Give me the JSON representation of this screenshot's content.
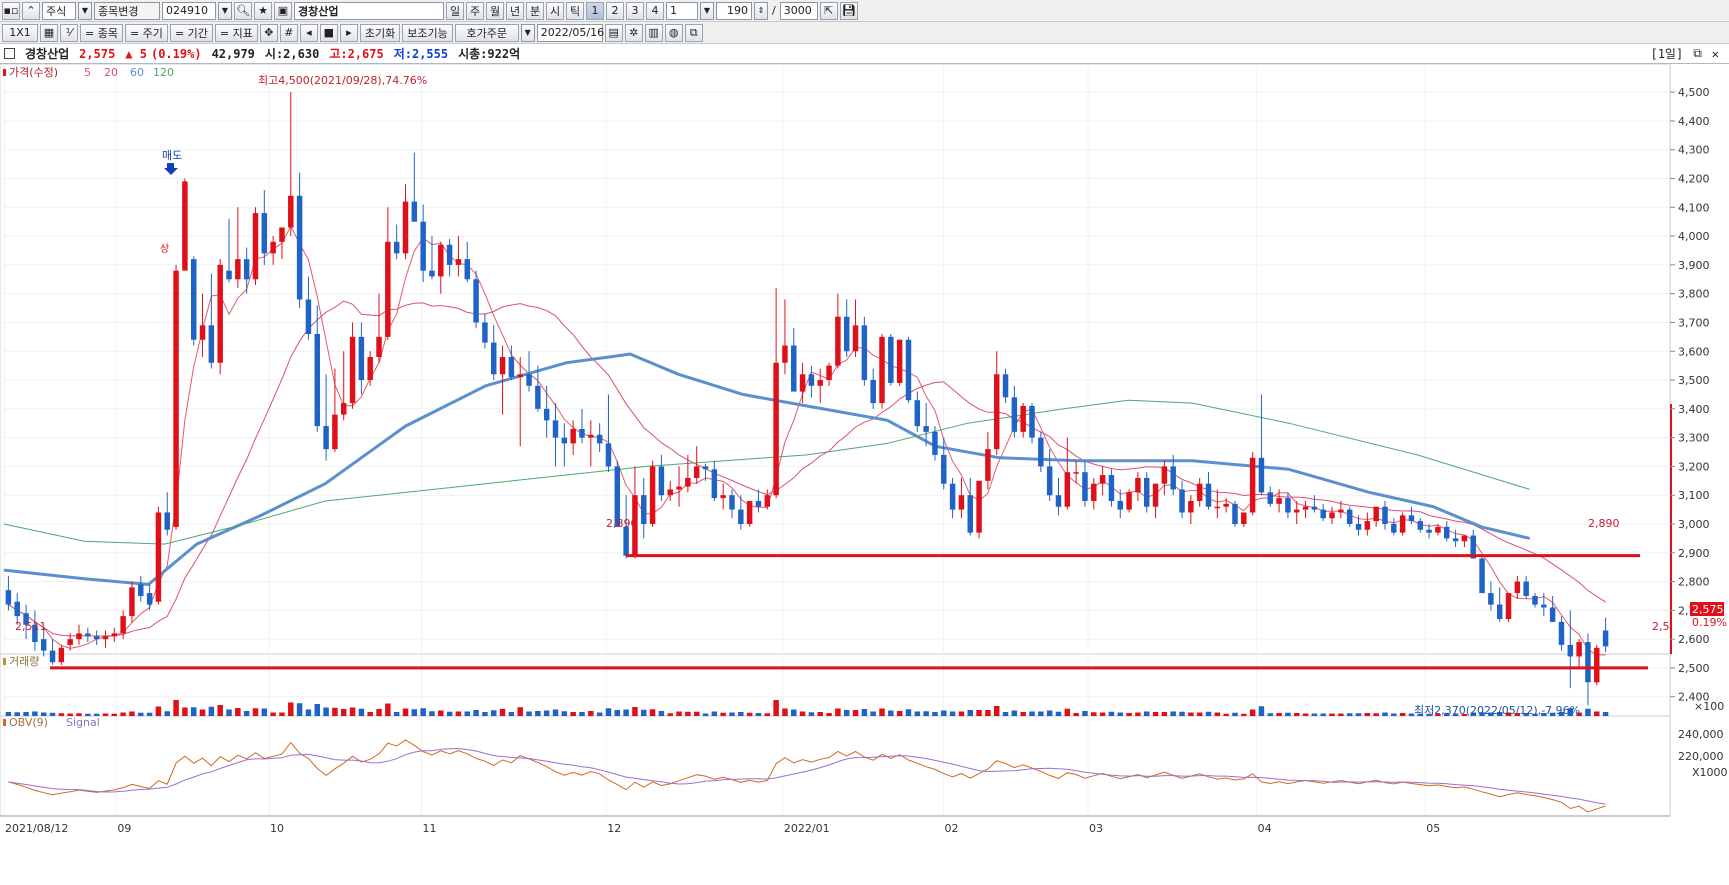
{
  "toolbar1": {
    "market": "주식",
    "stock_change": "종목변경",
    "code": "024910",
    "name": "경창산업",
    "periods": [
      "일",
      "주",
      "월",
      "년",
      "분",
      "시",
      "틱"
    ],
    "nums": [
      "1",
      "2",
      "3",
      "4"
    ],
    "interval": "1",
    "count": "190",
    "total": "3000"
  },
  "toolbar2": {
    "grid": "1X1",
    "buttons": [
      "= 종목",
      "= 주기",
      "= 기간",
      "= 지표"
    ],
    "reset": "초기화",
    "aux": "보조기능",
    "order": "호가주문",
    "date": "2022/05/16"
  },
  "info": {
    "name": "경창산업",
    "price": "2,575",
    "change": "▲ 5",
    "change_pct": "(0.19%)",
    "volume": "42,979",
    "open": "시:2,630",
    "high": "고:2,675",
    "low": "저:2,555",
    "mcap": "시총:922억",
    "period_badge": "[1일]"
  },
  "legend": {
    "price": "가격(수정)",
    "ma": [
      "5",
      "20",
      "60",
      "120"
    ],
    "volume": "거래량",
    "obv": "OBV(9)",
    "signal": "Signal"
  },
  "colors": {
    "up": "#e0101a",
    "down": "#1f63c6",
    "ma5": "#e25a6a",
    "ma20": "#d8507a",
    "ma60": "#5b8fd0",
    "ma120": "#4daa6e",
    "obv": "#d06a20",
    "signal": "#9a70d0"
  },
  "annotations": {
    "high": "최고4,500(2021/09/28),74.76%",
    "low": "최저2,370(2022/05/12),-7.96%",
    "sell": "매도",
    "limit_up": "상",
    "level1_left": "2,890",
    "level1_right": "2,890",
    "level2_left": "2,511",
    "level2_right": "2,5",
    "last_price": "2,575",
    "last_pct": "0.19%"
  },
  "axis": {
    "price_ticks": [
      "4,500",
      "4,400",
      "4,300",
      "4,200",
      "4,100",
      "4,000",
      "3,900",
      "3,800",
      "3,700",
      "3,600",
      "3,500",
      "3,400",
      "3,300",
      "3,200",
      "3,100",
      "3,000",
      "2,900",
      "2,800",
      "2,700",
      "2,600",
      "2,500",
      "2,400"
    ],
    "volume_unit": "×100",
    "obv_ticks": [
      "240,000",
      "220,000"
    ],
    "obv_unit": "X1000",
    "x_labels": [
      "2021/08/12",
      "09",
      "10",
      "11",
      "12",
      "2022/01",
      "02",
      "03",
      "04",
      "05"
    ]
  },
  "chart_data": {
    "type": "candlestick",
    "ylim": [
      2340,
      4570
    ],
    "levels": [
      2890,
      2500
    ],
    "candles": [
      [
        2770,
        2820,
        2700,
        2720
      ],
      [
        2730,
        2760,
        2650,
        2680
      ],
      [
        2690,
        2720,
        2600,
        2650
      ],
      [
        2650,
        2700,
        2560,
        2590
      ],
      [
        2600,
        2640,
        2540,
        2560
      ],
      [
        2560,
        2600,
        2511,
        2520
      ],
      [
        2520,
        2580,
        2510,
        2570
      ],
      [
        2580,
        2620,
        2560,
        2600
      ],
      [
        2600,
        2650,
        2580,
        2620
      ],
      [
        2620,
        2640,
        2590,
        2610
      ],
      [
        2610,
        2630,
        2580,
        2600
      ],
      [
        2600,
        2630,
        2570,
        2610
      ],
      [
        2610,
        2640,
        2590,
        2620
      ],
      [
        2620,
        2700,
        2600,
        2680
      ],
      [
        2680,
        2800,
        2660,
        2780
      ],
      [
        2790,
        2820,
        2730,
        2750
      ],
      [
        2760,
        2790,
        2700,
        2720
      ],
      [
        2730,
        3060,
        2720,
        3040
      ],
      [
        3040,
        3110,
        2960,
        2980
      ],
      [
        2990,
        3900,
        2980,
        3880
      ],
      [
        3880,
        4200,
        3900,
        4190
      ],
      [
        3920,
        3930,
        3620,
        3640
      ],
      [
        3640,
        3800,
        3580,
        3690
      ],
      [
        3690,
        3870,
        3540,
        3560
      ],
      [
        3560,
        3920,
        3520,
        3900
      ],
      [
        3880,
        4060,
        3840,
        3850
      ],
      [
        3850,
        4100,
        3820,
        3920
      ],
      [
        3920,
        3960,
        3800,
        3850
      ],
      [
        3850,
        4100,
        3830,
        4080
      ],
      [
        4080,
        4160,
        3900,
        3940
      ],
      [
        3940,
        4000,
        3900,
        3980
      ],
      [
        3980,
        4020,
        3920,
        4030
      ],
      [
        4030,
        4500,
        4000,
        4140
      ],
      [
        4140,
        4220,
        3750,
        3780
      ],
      [
        3780,
        3860,
        3640,
        3660
      ],
      [
        3660,
        3760,
        3320,
        3340
      ],
      [
        3340,
        3520,
        3220,
        3260
      ],
      [
        3260,
        3540,
        3250,
        3380
      ],
      [
        3380,
        3600,
        3360,
        3420
      ],
      [
        3420,
        3700,
        3400,
        3650
      ],
      [
        3650,
        3700,
        3450,
        3500
      ],
      [
        3500,
        3600,
        3480,
        3580
      ],
      [
        3580,
        3800,
        3560,
        3650
      ],
      [
        3650,
        4100,
        3640,
        3980
      ],
      [
        3980,
        4040,
        3920,
        3940
      ],
      [
        3940,
        4180,
        3920,
        4120
      ],
      [
        4120,
        4290,
        4060,
        4050
      ],
      [
        4050,
        4110,
        3840,
        3880
      ],
      [
        3880,
        4000,
        3850,
        3860
      ],
      [
        3860,
        3980,
        3800,
        3970
      ],
      [
        3970,
        3990,
        3860,
        3900
      ],
      [
        3900,
        4000,
        3860,
        3920
      ],
      [
        3920,
        3980,
        3840,
        3850
      ],
      [
        3850,
        3880,
        3680,
        3700
      ],
      [
        3700,
        3730,
        3610,
        3630
      ],
      [
        3630,
        3690,
        3500,
        3520
      ],
      [
        3520,
        3620,
        3380,
        3580
      ],
      [
        3580,
        3620,
        3500,
        3510
      ],
      [
        3510,
        3580,
        3270,
        3520
      ],
      [
        3520,
        3600,
        3460,
        3480
      ],
      [
        3480,
        3550,
        3390,
        3400
      ],
      [
        3400,
        3480,
        3300,
        3360
      ],
      [
        3360,
        3420,
        3200,
        3300
      ],
      [
        3300,
        3350,
        3200,
        3280
      ],
      [
        3280,
        3360,
        3240,
        3330
      ],
      [
        3330,
        3400,
        3280,
        3300
      ],
      [
        3300,
        3360,
        3200,
        3310
      ],
      [
        3310,
        3350,
        3250,
        3280
      ],
      [
        3280,
        3450,
        3180,
        3200
      ],
      [
        3200,
        3220,
        3020,
        2990
      ],
      [
        2990,
        3100,
        2880,
        2890
      ],
      [
        2890,
        3200,
        2880,
        3100
      ],
      [
        3100,
        3160,
        2950,
        3000
      ],
      [
        3000,
        3220,
        2990,
        3200
      ],
      [
        3200,
        3240,
        3080,
        3100
      ],
      [
        3100,
        3150,
        3080,
        3120
      ],
      [
        3120,
        3200,
        3060,
        3130
      ],
      [
        3130,
        3240,
        3110,
        3160
      ],
      [
        3160,
        3270,
        3140,
        3200
      ],
      [
        3200,
        3210,
        3150,
        3190
      ],
      [
        3190,
        3220,
        3080,
        3090
      ],
      [
        3090,
        3140,
        3050,
        3100
      ],
      [
        3100,
        3120,
        3020,
        3050
      ],
      [
        3050,
        3100,
        2980,
        3000
      ],
      [
        3000,
        3080,
        2990,
        3080
      ],
      [
        3080,
        3120,
        3040,
        3060
      ],
      [
        3060,
        3120,
        3050,
        3100
      ],
      [
        3100,
        3820,
        3090,
        3560
      ],
      [
        3560,
        3780,
        3520,
        3620
      ],
      [
        3620,
        3680,
        3460,
        3460
      ],
      [
        3460,
        3560,
        3420,
        3520
      ],
      [
        3520,
        3550,
        3440,
        3480
      ],
      [
        3480,
        3540,
        3420,
        3500
      ],
      [
        3500,
        3560,
        3480,
        3550
      ],
      [
        3550,
        3800,
        3540,
        3720
      ],
      [
        3720,
        3780,
        3580,
        3600
      ],
      [
        3600,
        3780,
        3580,
        3690
      ],
      [
        3690,
        3720,
        3480,
        3500
      ],
      [
        3500,
        3540,
        3400,
        3420
      ],
      [
        3420,
        3660,
        3400,
        3650
      ],
      [
        3650,
        3660,
        3480,
        3490
      ],
      [
        3490,
        3640,
        3480,
        3640
      ],
      [
        3640,
        3650,
        3420,
        3430
      ],
      [
        3430,
        3460,
        3320,
        3340
      ],
      [
        3340,
        3420,
        3270,
        3320
      ],
      [
        3320,
        3340,
        3220,
        3240
      ],
      [
        3240,
        3300,
        3120,
        3140
      ],
      [
        3140,
        3160,
        3020,
        3050
      ],
      [
        3050,
        3160,
        3020,
        3100
      ],
      [
        3100,
        3160,
        2960,
        2970
      ],
      [
        2970,
        3150,
        2950,
        3150
      ],
      [
        3150,
        3320,
        3120,
        3260
      ],
      [
        3260,
        3600,
        3240,
        3520
      ],
      [
        3520,
        3540,
        3420,
        3440
      ],
      [
        3440,
        3480,
        3300,
        3320
      ],
      [
        3320,
        3420,
        3300,
        3410
      ],
      [
        3410,
        3420,
        3280,
        3300
      ],
      [
        3300,
        3320,
        3180,
        3200
      ],
      [
        3200,
        3260,
        3080,
        3100
      ],
      [
        3100,
        3160,
        3030,
        3060
      ],
      [
        3060,
        3300,
        3050,
        3180
      ],
      [
        3180,
        3220,
        3140,
        3180
      ],
      [
        3180,
        3220,
        3060,
        3080
      ],
      [
        3080,
        3160,
        3050,
        3140
      ],
      [
        3140,
        3200,
        3100,
        3170
      ],
      [
        3170,
        3190,
        3060,
        3080
      ],
      [
        3080,
        3120,
        3020,
        3050
      ],
      [
        3050,
        3120,
        3040,
        3110
      ],
      [
        3110,
        3180,
        3080,
        3160
      ],
      [
        3160,
        3180,
        3040,
        3060
      ],
      [
        3060,
        3140,
        3020,
        3140
      ],
      [
        3140,
        3220,
        3100,
        3200
      ],
      [
        3200,
        3240,
        3100,
        3120
      ],
      [
        3120,
        3150,
        3020,
        3040
      ],
      [
        3040,
        3100,
        3000,
        3080
      ],
      [
        3080,
        3160,
        3060,
        3140
      ],
      [
        3140,
        3180,
        3050,
        3060
      ],
      [
        3060,
        3120,
        3020,
        3060
      ],
      [
        3060,
        3090,
        3040,
        3070
      ],
      [
        3070,
        3080,
        2990,
        3000
      ],
      [
        3000,
        3040,
        2990,
        3040
      ],
      [
        3040,
        3250,
        3030,
        3230
      ],
      [
        3230,
        3450,
        3100,
        3110
      ],
      [
        3110,
        3130,
        3060,
        3070
      ],
      [
        3070,
        3120,
        3040,
        3090
      ],
      [
        3090,
        3110,
        3020,
        3040
      ],
      [
        3040,
        3080,
        3000,
        3050
      ],
      [
        3050,
        3080,
        3020,
        3060
      ],
      [
        3060,
        3100,
        3040,
        3050
      ],
      [
        3050,
        3070,
        3010,
        3020
      ],
      [
        3020,
        3060,
        3000,
        3040
      ],
      [
        3040,
        3080,
        3020,
        3050
      ],
      [
        3050,
        3060,
        2990,
        3000
      ],
      [
        3000,
        3030,
        2960,
        2980
      ],
      [
        2980,
        3040,
        2960,
        3010
      ],
      [
        3010,
        3060,
        2990,
        3060
      ],
      [
        3060,
        3080,
        2980,
        3000
      ],
      [
        3000,
        3020,
        2960,
        2970
      ],
      [
        2970,
        3040,
        2960,
        3030
      ],
      [
        3030,
        3060,
        3000,
        3010
      ],
      [
        3010,
        3020,
        2970,
        2980
      ],
      [
        2980,
        3000,
        2950,
        2970
      ],
      [
        2970,
        3000,
        2960,
        2990
      ],
      [
        2990,
        3010,
        2940,
        2950
      ],
      [
        2950,
        2980,
        2920,
        2940
      ],
      [
        2940,
        2960,
        2920,
        2960
      ],
      [
        2960,
        2980,
        2880,
        2880
      ],
      [
        2880,
        2890,
        2780,
        2760
      ],
      [
        2760,
        2800,
        2700,
        2720
      ],
      [
        2720,
        2780,
        2660,
        2670
      ],
      [
        2670,
        2760,
        2660,
        2760
      ],
      [
        2760,
        2820,
        2740,
        2800
      ],
      [
        2800,
        2820,
        2740,
        2750
      ],
      [
        2750,
        2760,
        2710,
        2720
      ],
      [
        2720,
        2760,
        2680,
        2710
      ],
      [
        2710,
        2750,
        2660,
        2660
      ],
      [
        2660,
        2680,
        2560,
        2580
      ],
      [
        2580,
        2700,
        2430,
        2540
      ],
      [
        2540,
        2600,
        2500,
        2590
      ],
      [
        2590,
        2620,
        2370,
        2450
      ],
      [
        2450,
        2580,
        2440,
        2570
      ],
      [
        2630,
        2675,
        2555,
        2575
      ]
    ],
    "ma60": [
      [
        0,
        2840
      ],
      [
        0.05,
        2810
      ],
      [
        0.09,
        2790
      ],
      [
        0.12,
        2930
      ],
      [
        0.16,
        3030
      ],
      [
        0.2,
        3140
      ],
      [
        0.25,
        3340
      ],
      [
        0.3,
        3480
      ],
      [
        0.35,
        3560
      ],
      [
        0.39,
        3590
      ],
      [
        0.42,
        3520
      ],
      [
        0.46,
        3450
      ],
      [
        0.5,
        3410
      ],
      [
        0.55,
        3360
      ],
      [
        0.58,
        3270
      ],
      [
        0.62,
        3230
      ],
      [
        0.67,
        3220
      ],
      [
        0.74,
        3220
      ],
      [
        0.8,
        3190
      ],
      [
        0.85,
        3110
      ],
      [
        0.89,
        3060
      ],
      [
        0.92,
        2990
      ],
      [
        0.95,
        2950
      ]
    ],
    "ma120": [
      [
        0,
        3000
      ],
      [
        0.05,
        2940
      ],
      [
        0.1,
        2930
      ],
      [
        0.15,
        3000
      ],
      [
        0.2,
        3080
      ],
      [
        0.3,
        3140
      ],
      [
        0.4,
        3200
      ],
      [
        0.5,
        3240
      ],
      [
        0.55,
        3280
      ],
      [
        0.6,
        3350
      ],
      [
        0.66,
        3400
      ],
      [
        0.7,
        3430
      ],
      [
        0.74,
        3420
      ],
      [
        0.8,
        3350
      ],
      [
        0.88,
        3240
      ],
      [
        0.95,
        3120
      ]
    ]
  }
}
